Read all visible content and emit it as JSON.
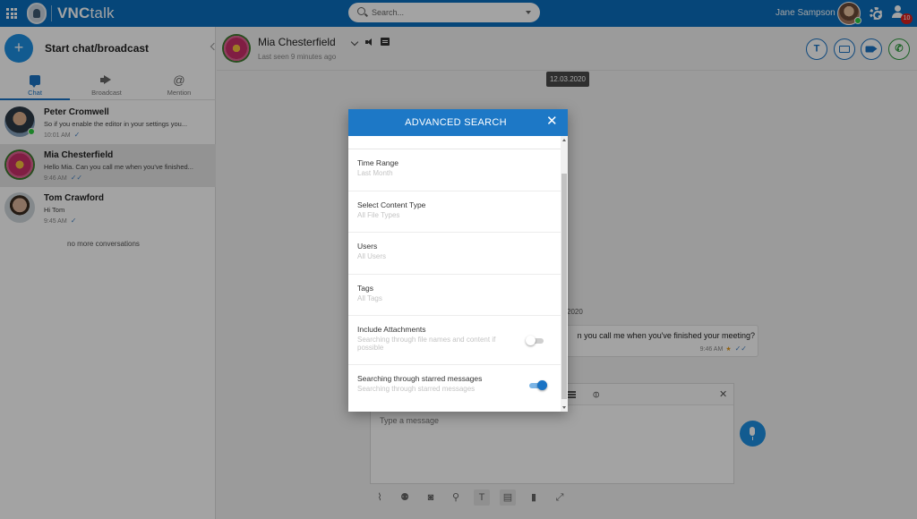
{
  "topbar": {
    "brand_prefix": "VNC",
    "brand_suffix": "talk",
    "search_placeholder": "Search...",
    "user_name": "Jane Sampson",
    "notification_count": "10"
  },
  "sidebar": {
    "new_chat_label": "Start chat/broadcast",
    "new_chat_symbol": "+",
    "tabs": [
      {
        "label": "Chat",
        "icon": "chat-icon",
        "active": true
      },
      {
        "label": "Broadcast",
        "icon": "megaphone-icon",
        "active": false
      },
      {
        "label": "Mention",
        "icon": "at-icon",
        "active": false
      }
    ],
    "conversations": [
      {
        "name": "Peter Cromwell",
        "snippet": "So if you enable the editor in your settings you...",
        "time": "10:01 AM",
        "status": "✓"
      },
      {
        "name": "Mia Chesterfield",
        "snippet": "Hello Mia. Can you call me when you've finished...",
        "time": "9:46 AM",
        "status": "✓✓"
      },
      {
        "name": "Tom Crawford",
        "snippet": "Hi Tom",
        "time": "9:45 AM",
        "status": "✓"
      }
    ],
    "end_text": "no more conversations"
  },
  "chat": {
    "contact_name": "Mia Chesterfield",
    "last_seen": "Last seen 9 minutes ago",
    "date_chip": "12.03.2020",
    "date_partial": "2020",
    "message_text": "n you call me when you've finished your meeting?",
    "message_time": "9:46 AM",
    "composer_placeholder": "Type a message",
    "accent_color": "#1a73c4"
  },
  "dialog": {
    "title": "ADVANCED SEARCH",
    "close_symbol": "✕",
    "options": [
      {
        "label": "Time Range",
        "value": "Last Month"
      },
      {
        "label": "Select Content Type",
        "value": "All File Types"
      },
      {
        "label": "Users",
        "value": "All Users"
      },
      {
        "label": "Tags",
        "value": "All Tags"
      },
      {
        "label": "Include Attachments",
        "value": "Searching through file names and content if possible",
        "toggle": false
      },
      {
        "label": "Searching through starred messages",
        "value": "Searching through starred messages",
        "toggle": true
      }
    ]
  }
}
